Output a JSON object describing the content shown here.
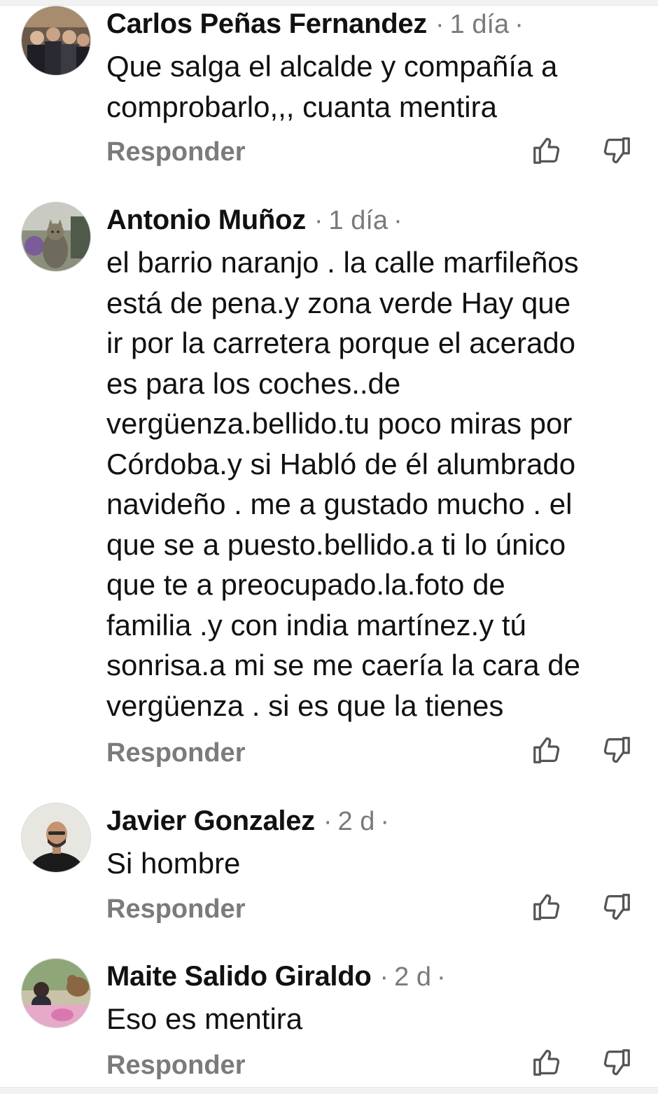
{
  "comments": [
    {
      "author": "Carlos Peñas Fernandez",
      "time": "1 día",
      "separator": "·",
      "text": "Que salga el alcalde y compañía a\ncomprobarlo,,, cuanta mentira",
      "reply_label": "Responder"
    },
    {
      "author": "Antonio Muñoz",
      "time": "1 día",
      "separator": "·",
      "text": "el barrio naranjo . la calle marfileños\nestá de pena.y zona verde Hay que\nir por la carretera porque el acerado\nes para los coches..de\nvergüenza.bellido.tu poco miras por\nCórdoba.y si Habló de él alumbrado\nnavideño . me a gustado mucho . el\nque se a puesto.bellido.a ti lo único\nque te a preocupado.la.foto de\nfamilia .y con india martínez.y tú\nsonrisa.a mi se me caería la cara de\nvergüenza . si es que la tienes",
      "reply_label": "Responder"
    },
    {
      "author": "Javier Gonzalez",
      "time": "2 d",
      "separator": "·",
      "text": "Si hombre",
      "reply_label": "Responder"
    },
    {
      "author": "Maite Salido Giraldo",
      "time": "2 d",
      "separator": "·",
      "text": "Eso es mentira",
      "reply_label": "Responder"
    }
  ],
  "icons": {
    "like": "thumbs-up-icon",
    "dislike": "thumbs-down-icon"
  },
  "colors": {
    "author": "#111111",
    "meta": "#7a7a7a",
    "reply": "#7b7b7b",
    "icon_stroke": "#555555"
  }
}
